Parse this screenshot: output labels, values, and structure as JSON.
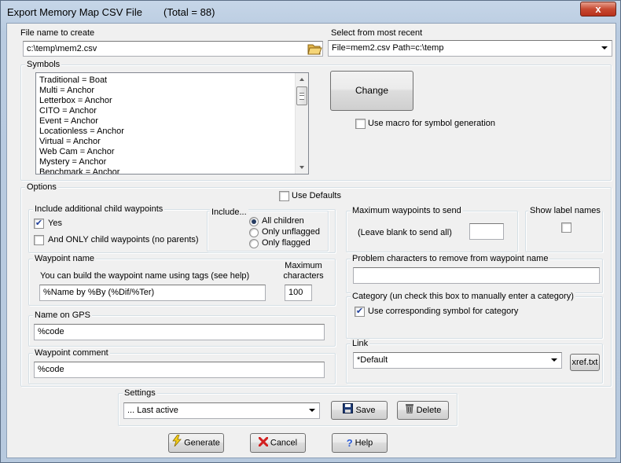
{
  "window": {
    "title": "Export Memory Map CSV File",
    "total": "(Total = 88)",
    "close_glyph": "x"
  },
  "file": {
    "label": "File name to create",
    "value": "c:\\temp\\mem2.csv",
    "browse_icon": "folder-open-icon"
  },
  "recent": {
    "label": "Select from most recent",
    "value": "File=mem2.csv Path=c:\\temp"
  },
  "symbols": {
    "title": "Symbols",
    "items": [
      "Traditional = Boat",
      "Multi = Anchor",
      "Letterbox = Anchor",
      "CITO = Anchor",
      "Event = Anchor",
      "Locationless = Anchor",
      "Virtual = Anchor",
      "Web Cam = Anchor",
      "Mystery = Anchor",
      "Benchmark = Anchor"
    ],
    "change_label": "Change",
    "macro_label": "Use macro for symbol generation",
    "macro_checked": false
  },
  "options": {
    "title": "Options",
    "use_defaults_label": "Use Defaults",
    "use_defaults_checked": false,
    "child": {
      "title": "Include additional child waypoints",
      "yes_label": "Yes",
      "yes_checked": true,
      "only_label": "And ONLY child waypoints (no parents)",
      "only_checked": false,
      "include_title": "Include...",
      "radios": [
        {
          "label": "All children",
          "selected": true
        },
        {
          "label": "Only unflagged",
          "selected": false
        },
        {
          "label": "Only flagged",
          "selected": false
        }
      ]
    },
    "max_waypoints": {
      "title": "Maximum waypoints to send",
      "hint": "(Leave blank to send all)",
      "value": ""
    },
    "show_label_names": {
      "title": "Show label names",
      "checked": false
    },
    "waypoint_name": {
      "title": "Waypoint name",
      "help": "You can build the waypoint name using tags (see help)",
      "value": "%Name by %By (%Dif/%Ter)",
      "max_chars_label_1": "Maximum",
      "max_chars_label_2": "characters",
      "max_chars_value": "100"
    },
    "problem_chars": {
      "title": "Problem characters to remove from waypoint name",
      "value": ""
    },
    "name_on_gps": {
      "title": "Name on GPS",
      "value": "%code"
    },
    "category": {
      "title": "Category (un check this box to manually enter a category)",
      "checkbox_label": "Use corresponding symbol for category",
      "checked": true
    },
    "waypoint_comment": {
      "title": "Waypoint comment",
      "value": "%code"
    },
    "link": {
      "title": "Link",
      "value": "*Default",
      "xref_label": "xref.txt"
    }
  },
  "settings": {
    "title": "Settings",
    "value": "... Last active",
    "save_label": "Save",
    "delete_label": "Delete"
  },
  "footer": {
    "generate_label": "Generate",
    "cancel_label": "Cancel",
    "help_label": "Help"
  },
  "colors": {
    "dialog_bg": "#f0f0f0",
    "frame": "#b9cbe0",
    "close_red": "#c74a32",
    "check_blue": "#21409a"
  }
}
